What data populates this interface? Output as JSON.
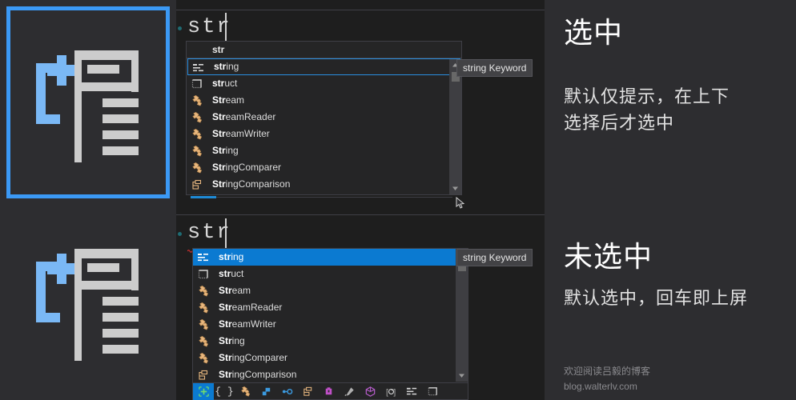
{
  "app": {
    "background": "#2d2d30",
    "editor_background": "#1e1e1e",
    "popup_background": "#252526",
    "accent_blue": "#0b7ad1",
    "highlight_border": "#2a8fe0",
    "card_border": "#3b99f5"
  },
  "left_panel": {
    "cards": [
      {
        "name": "intellisense-icon-selected",
        "selected": true,
        "icon": "intellisense-list-icon"
      },
      {
        "name": "intellisense-icon-unselected",
        "selected": false,
        "icon": "intellisense-list-icon"
      }
    ]
  },
  "editors": [
    {
      "id": "editor-top",
      "code_text": "str",
      "has_error_squiggle": true,
      "popup": {
        "header_label": "str",
        "selection_mode": "outline",
        "tooltip": "string Keyword",
        "items": [
          {
            "icon": "keyword-icon",
            "prefix": "str",
            "suffix": "ing",
            "selected": true
          },
          {
            "icon": "struct-icon",
            "prefix": "str",
            "suffix": "uct",
            "selected": false
          },
          {
            "icon": "class-icon",
            "prefix": "Str",
            "suffix": "eam",
            "selected": false
          },
          {
            "icon": "class-icon",
            "prefix": "Str",
            "suffix": "eamReader",
            "selected": false
          },
          {
            "icon": "class-icon",
            "prefix": "Str",
            "suffix": "eamWriter",
            "selected": false
          },
          {
            "icon": "class-icon",
            "prefix": "Str",
            "suffix": "ing",
            "selected": false
          },
          {
            "icon": "class-icon",
            "prefix": "Str",
            "suffix": "ingComparer",
            "selected": false
          },
          {
            "icon": "enum-icon",
            "prefix": "Str",
            "suffix": "ingComparison",
            "selected": false
          }
        ]
      }
    },
    {
      "id": "editor-bottom",
      "code_text": "str",
      "has_error_squiggle": true,
      "popup": {
        "header_label": "",
        "selection_mode": "filled",
        "tooltip": "string Keyword",
        "items": [
          {
            "icon": "keyword-icon",
            "prefix": "str",
            "suffix": "ing",
            "selected": true
          },
          {
            "icon": "struct-icon",
            "prefix": "str",
            "suffix": "uct",
            "selected": false
          },
          {
            "icon": "class-icon",
            "prefix": "Str",
            "suffix": "eam",
            "selected": false
          },
          {
            "icon": "class-icon",
            "prefix": "Str",
            "suffix": "eamReader",
            "selected": false
          },
          {
            "icon": "class-icon",
            "prefix": "Str",
            "suffix": "eamWriter",
            "selected": false
          },
          {
            "icon": "class-icon",
            "prefix": "Str",
            "suffix": "ing",
            "selected": false
          },
          {
            "icon": "class-icon",
            "prefix": "Str",
            "suffix": "ingComparer",
            "selected": false
          },
          {
            "icon": "enum-icon",
            "prefix": "Str",
            "suffix": "ingComparison",
            "selected": false
          }
        ],
        "filter_bar": [
          {
            "icon": "all-members-icon",
            "active": true
          },
          {
            "icon": "snippet-icon",
            "active": false
          },
          {
            "icon": "class-icon",
            "active": false
          },
          {
            "icon": "struct-blue-icon",
            "active": false
          },
          {
            "icon": "interface-icon",
            "active": false
          },
          {
            "icon": "enum-icon",
            "active": false
          },
          {
            "icon": "delegate-icon",
            "active": false
          },
          {
            "icon": "extension-icon",
            "active": false
          },
          {
            "icon": "namespace-icon",
            "active": false
          },
          {
            "icon": "property-icon",
            "active": false
          },
          {
            "icon": "keyword-icon",
            "active": false
          },
          {
            "icon": "struct-icon",
            "active": false
          }
        ]
      }
    }
  ],
  "annotations": {
    "top": {
      "title": "选中",
      "body_line1": "默认仅提示，在上下",
      "body_line2": "选择后才选中"
    },
    "bottom": {
      "title": "未选中",
      "body_line1": "默认选中，回车即上屏"
    },
    "footer": {
      "line1": "欢迎阅读吕毅的博客",
      "line2": "blog.walterlv.com"
    }
  }
}
